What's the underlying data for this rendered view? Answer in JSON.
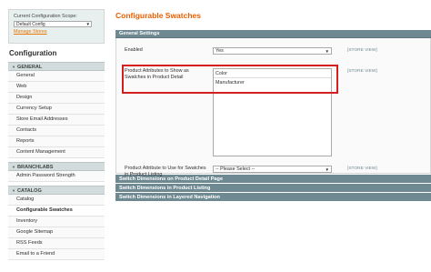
{
  "scope": {
    "label": "Current Configuration Scope:",
    "selected": "Default Config",
    "manage_link": "Manage Stores"
  },
  "sidebar": {
    "title": "Configuration",
    "groups": [
      {
        "title": "GENERAL",
        "items": [
          "General",
          "Web",
          "Design",
          "Currency Setup",
          "Store Email Addresses",
          "Contacts",
          "Reports",
          "Content Management"
        ]
      },
      {
        "title": "BRANCHLABS",
        "items": [
          "Admin Password Strength"
        ]
      },
      {
        "title": "CATALOG",
        "items": [
          "Catalog",
          "Configurable Swatches",
          "Inventory",
          "Google Sitemap",
          "RSS Feeds",
          "Email to a Friend"
        ]
      }
    ],
    "active_item": "Configurable Swatches"
  },
  "main": {
    "title": "Configurable Swatches",
    "section_title": "General Settings",
    "fields": {
      "enabled": {
        "label": "Enabled",
        "value": "Yes",
        "scope": "[STORE VIEW]"
      },
      "swatch_attrs": {
        "label": "Product Attributes to Show as Swatches in Product Detail",
        "options": [
          "Color",
          "Manufacturer"
        ],
        "scope": "[STORE VIEW]"
      },
      "listing_attr": {
        "label": "Product Attribute to Use for Swatches in Product Listing",
        "value": "-- Please Select --",
        "scope": "[STORE VIEW]"
      }
    },
    "collapsed_sections": [
      "Switch Dimensions on Product Detail Page",
      "Switch Dimensions in Product Listing",
      "Switch Dimensions in Layered Navigation"
    ]
  },
  "colors": {
    "accent": "#eb5e00",
    "section_header": "#6f8992",
    "highlight": "#d51f1f"
  }
}
